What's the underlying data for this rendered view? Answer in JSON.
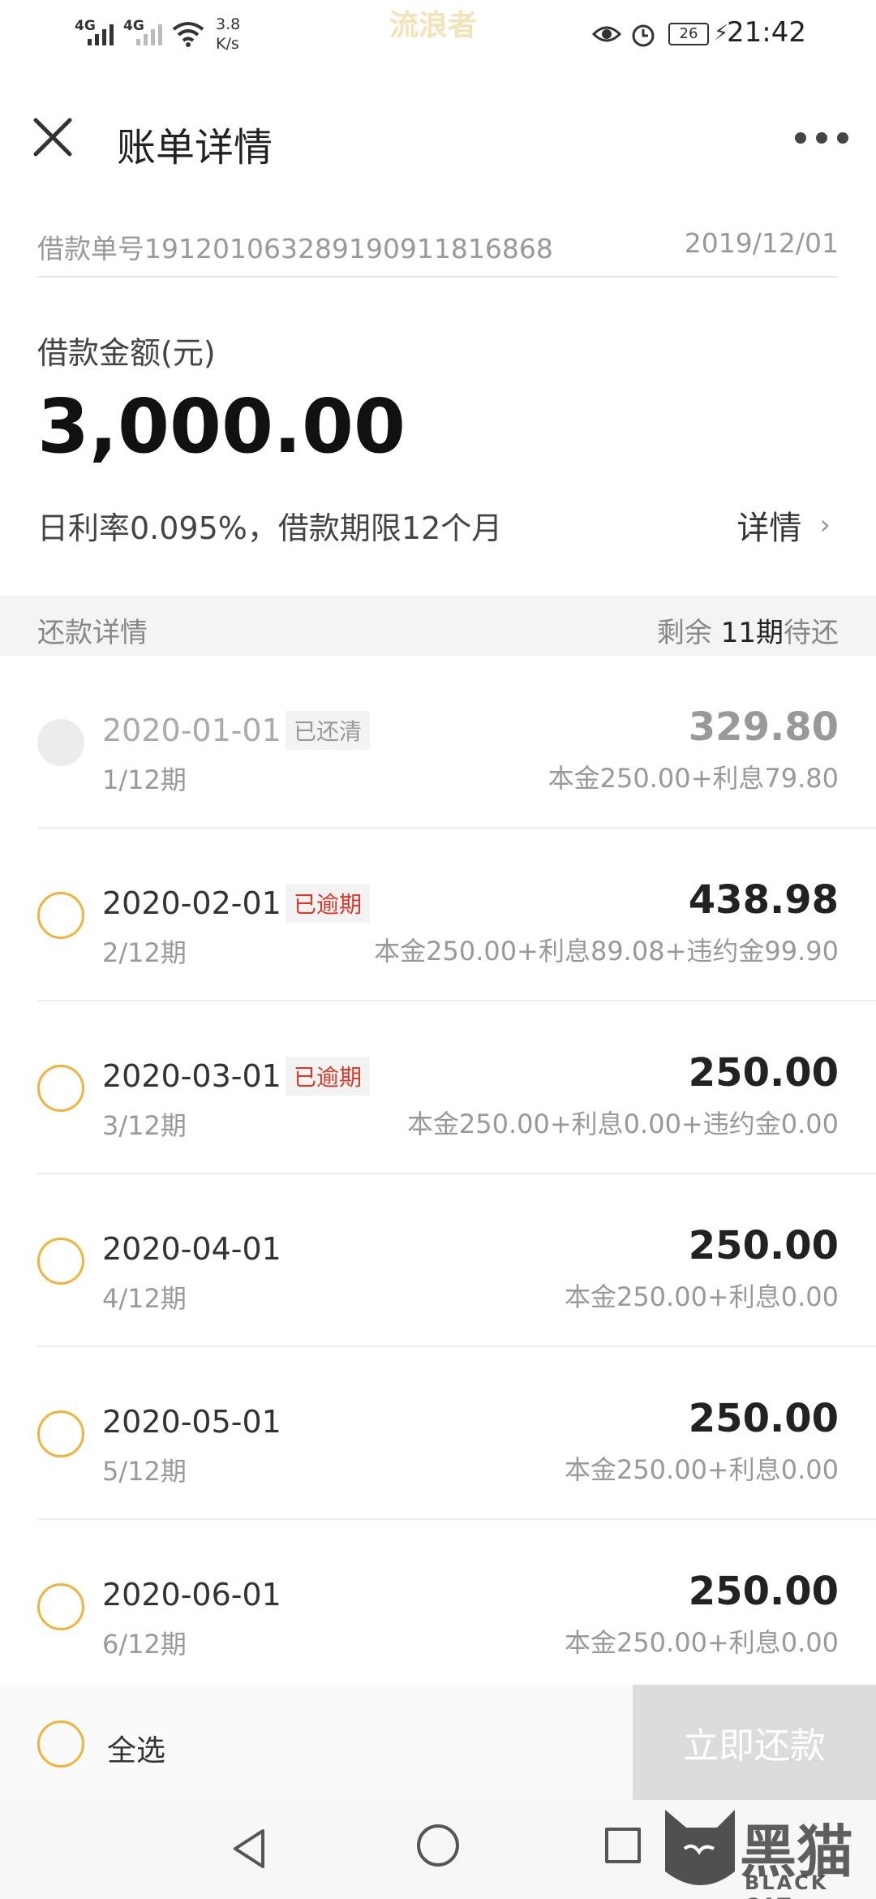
{
  "status_bar": {
    "net1": "4G",
    "net2": "4G",
    "speed_value": "3.8",
    "speed_unit": "K/s",
    "watermark": "流浪者",
    "battery": "26",
    "time": "21:42"
  },
  "header": {
    "title": "账单详情"
  },
  "order": {
    "number": "借款单号1912010632891909118168​68",
    "date": "2019/12/01"
  },
  "loan": {
    "amount_label": "借款金额(元)",
    "amount": "3,000.00",
    "terms": "日利率0.095%，借款期限12个月",
    "detail_link": "详情"
  },
  "repay_section": {
    "title": "还款详情",
    "remaining_prefix": "剩余 ",
    "remaining_count": "11期",
    "remaining_suffix": "待还"
  },
  "installments": [
    {
      "date": "2020-01-01",
      "period": "1/12期",
      "status": "已还清",
      "amount": "329.80",
      "breakdown": "本金250.00+利息79.80"
    },
    {
      "date": "2020-02-01",
      "period": "2/12期",
      "status": "已逾期",
      "amount": "438.98",
      "breakdown": "本金250.00+利息89.08+违约金99.90"
    },
    {
      "date": "2020-03-01",
      "period": "3/12期",
      "status": "已逾期",
      "amount": "250.00",
      "breakdown": "本金250.00+利息0.00+违约金0.00"
    },
    {
      "date": "2020-04-01",
      "period": "4/12期",
      "status": "",
      "amount": "250.00",
      "breakdown": "本金250.00+利息0.00"
    },
    {
      "date": "2020-05-01",
      "period": "5/12期",
      "status": "",
      "amount": "250.00",
      "breakdown": "本金250.00+利息0.00"
    },
    {
      "date": "2020-06-01",
      "period": "6/12期",
      "status": "",
      "amount": "250.00",
      "breakdown": "本金250.00+利息0.00"
    }
  ],
  "bottom": {
    "select_all": "全选",
    "pay_button": "立即还款"
  },
  "watermark": {
    "name": "黑猫",
    "sub": "BLACK CAT"
  },
  "colors": {
    "accent_circle": "#f0b43c",
    "overdue": "#d83a2a"
  }
}
